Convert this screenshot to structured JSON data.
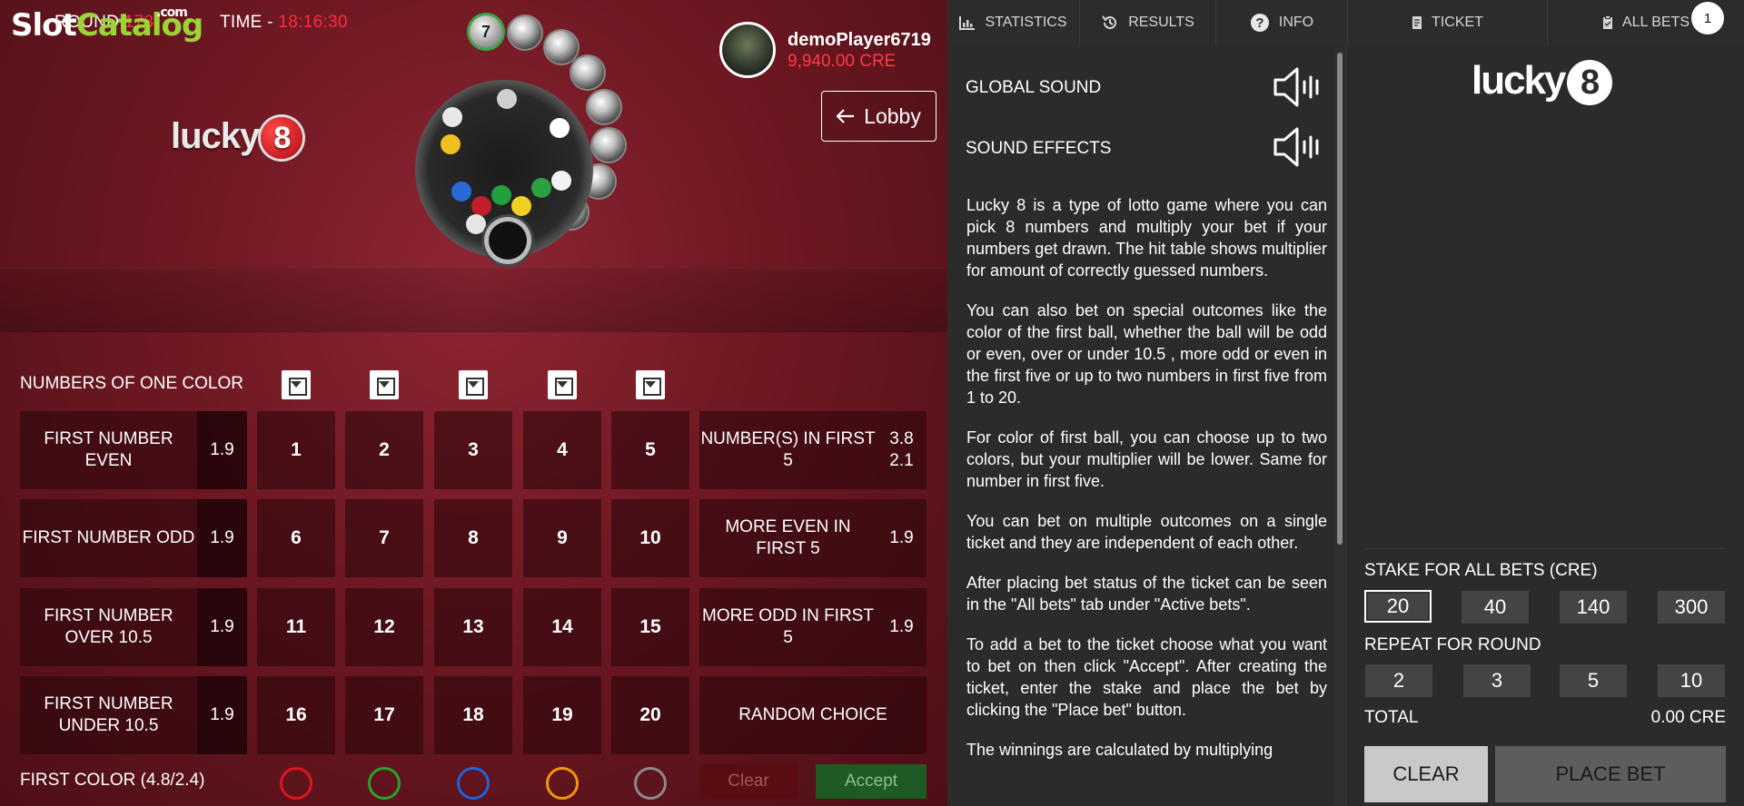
{
  "watermark": {
    "slot": "Slot",
    "catalog": "Catalog",
    "com": ".com"
  },
  "top": {
    "round_label": "ROUND",
    "round_value": "173",
    "time_label": "TIME -",
    "time_value": "18:16:30"
  },
  "game_logo": {
    "word": "lucky",
    "digit": "8"
  },
  "drum": {
    "last_ball": "7"
  },
  "player": {
    "name": "demoPlayer6719",
    "balance": "9,940.00 CRE"
  },
  "lobby": {
    "label": "Lobby",
    "icon": "arrow-left-icon"
  },
  "board": {
    "color_label": "NUMBERS OF ONE COLOR",
    "left_options": [
      {
        "label": "FIRST NUMBER EVEN",
        "multiplier": "1.9"
      },
      {
        "label": "FIRST NUMBER ODD",
        "multiplier": "1.9"
      },
      {
        "label": "FIRST NUMBER OVER 10.5",
        "multiplier": "1.9"
      },
      {
        "label": "FIRST NUMBER UNDER 10.5",
        "multiplier": "1.9"
      }
    ],
    "numbers": [
      "1",
      "2",
      "3",
      "4",
      "5",
      "6",
      "7",
      "8",
      "9",
      "10",
      "11",
      "12",
      "13",
      "14",
      "15",
      "16",
      "17",
      "18",
      "19",
      "20"
    ],
    "right_options": [
      {
        "label": "NUMBER(S) IN FIRST 5",
        "mult1": "3.8",
        "mult2": "2.1"
      },
      {
        "label": "MORE EVEN IN FIRST 5",
        "mult1": "1.9"
      },
      {
        "label": "MORE ODD IN FIRST 5",
        "mult1": "1.9"
      },
      {
        "label": "RANDOM CHOICE"
      }
    ],
    "first_color_label": "FIRST COLOR (4.8/2.4)",
    "colors": [
      "#e0141e",
      "#2aa02e",
      "#1e63d8",
      "#f0960a",
      "#8a8a8a"
    ],
    "clear_label": "Clear",
    "accept_label": "Accept"
  },
  "tabs": [
    {
      "label": "STATISTICS",
      "icon": "bar-chart-icon"
    },
    {
      "label": "RESULTS",
      "icon": "history-icon"
    },
    {
      "label": "INFO",
      "icon": "question-icon"
    },
    {
      "label": "TICKET",
      "icon": "ticket-icon"
    },
    {
      "label": "ALL BETS",
      "icon": "clipboard-icon"
    }
  ],
  "all_bets_count": "1",
  "info": {
    "global_sound": "GLOBAL SOUND",
    "sound_effects": "SOUND EFFECTS",
    "paragraphs": [
      "Lucky 8 is a type of lotto game where you can pick 8 numbers and multiply your bet if your numbers get drawn. The hit table shows multiplier for amount of correctly guessed numbers.",
      "You can also bet on special outcomes like the color of the first ball, whether the ball will be odd or even, over or under 10.5 , more odd or even in the first five or up to two numbers in first five from 1 to 20.",
      "For color of first ball, you can choose up to two colors, but your multiplier will be lower. Same for number in first five.",
      "You can bet on multiple outcomes on a single ticket and they are independent of each other.",
      "After placing bet status of the ticket can be seen in the \"All bets\" tab under \"Active bets\".",
      "To add a bet to the ticket choose what you want to bet on then click \"Accept\". After creating the ticket, enter the stake and place the bet by clicking the \"Place bet\" button.",
      "The winnings are calculated by multiplying"
    ]
  },
  "ticket": {
    "logo_word": "lucky",
    "logo_digit": "8",
    "stake_label": "STAKE FOR ALL BETS (CRE)",
    "stakes": [
      "20",
      "40",
      "140",
      "300"
    ],
    "repeat_label": "REPEAT FOR ROUND",
    "repeats": [
      "2",
      "3",
      "5",
      "10"
    ],
    "total_label": "TOTAL",
    "total_value": "0.00 CRE",
    "clear_label": "CLEAR",
    "place_bet_label": "PLACE BET"
  }
}
